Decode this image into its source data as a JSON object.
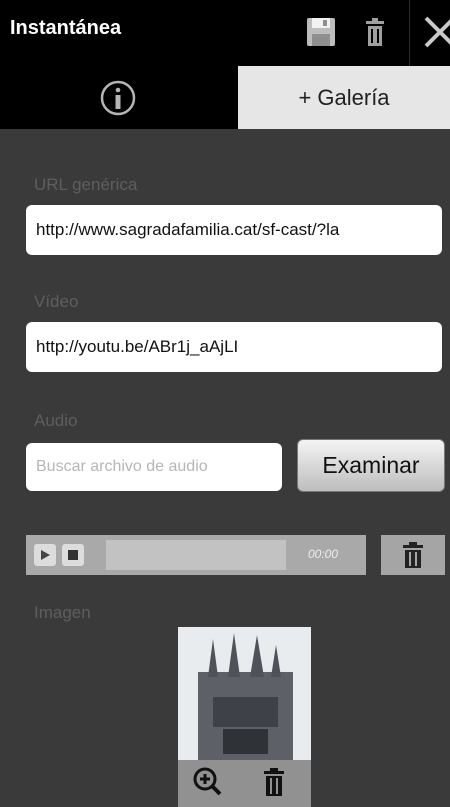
{
  "header": {
    "title": "Instantánea"
  },
  "tabs": {
    "gallery_label": "+ Galería"
  },
  "fields": {
    "url_label": "URL genérica",
    "url_value": "http://www.sagradafamilia.cat/sf-cast/?la",
    "video_label": "Vídeo",
    "video_value": "http://youtu.be/ABr1j_aAjLI",
    "audio_label": "Audio",
    "audio_placeholder": "Buscar archivo de audio",
    "browse_label": "Examinar"
  },
  "player": {
    "time": "00:00"
  },
  "image": {
    "label": "Imagen"
  },
  "icons": {
    "save": "save-icon",
    "trash": "trash-icon",
    "close": "close-icon",
    "info": "info-icon",
    "play": "play-icon",
    "stop": "stop-icon",
    "zoom": "zoom-in-icon"
  },
  "colors": {
    "header_bg": "#000000",
    "panel_bg": "#3a3a3a",
    "tab_active_bg": "#e6e6e6"
  }
}
